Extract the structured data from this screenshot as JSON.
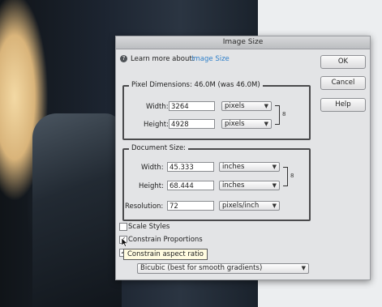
{
  "dialog": {
    "title": "Image Size",
    "learn_more_prefix": "Learn more about:",
    "learn_more_link": "Image Size",
    "buttons": {
      "ok": "OK",
      "cancel": "Cancel",
      "help": "Help"
    },
    "pixel_dimensions": {
      "legend": "Pixel Dimensions:  46.0M (was 46.0M)",
      "width_label": "Width:",
      "width_value": "3264",
      "width_unit": "pixels",
      "height_label": "Height:",
      "height_value": "4928",
      "height_unit": "pixels"
    },
    "document_size": {
      "legend": "Document Size:",
      "width_label": "Width:",
      "width_value": "45.333",
      "width_unit": "inches",
      "height_label": "Height:",
      "height_value": "68.444",
      "height_unit": "inches",
      "resolution_label": "Resolution:",
      "resolution_value": "72",
      "resolution_unit": "pixels/inch"
    },
    "options": {
      "scale_styles": {
        "label": "Scale Styles",
        "checked": false
      },
      "constrain_proportions": {
        "label": "Constrain Proportions",
        "checked": true
      },
      "resample": {
        "checked": true,
        "method": "Bicubic (best for smooth gradients)"
      }
    },
    "tooltip": "Constrain aspect ratio"
  },
  "icons": {
    "info": "info-icon",
    "link_pixel": "chain-link-icon",
    "link_document": "chain-link-icon",
    "dropdown": "chevron-down-icon",
    "cursor": "pointer-cursor-icon"
  },
  "colors": {
    "link": "#2f7fc9",
    "dialog_bg": "#e3e4e6",
    "tooltip_bg": "#fffbe0"
  }
}
